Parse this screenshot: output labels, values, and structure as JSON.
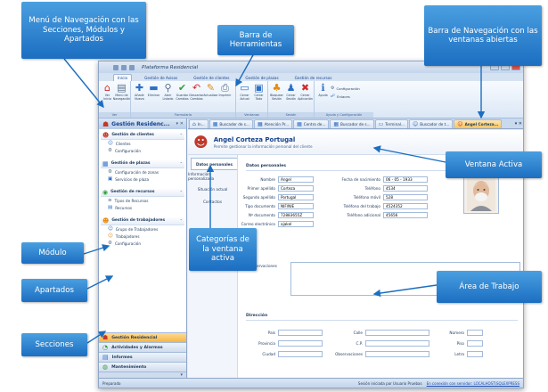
{
  "app": {
    "title": "Plataforma Residencial"
  },
  "ribbon_tabs": [
    "Inicio",
    "Gestión de Avisos",
    "Gestión de clientes",
    "Gestión de plazas",
    "Gestión de recursos"
  ],
  "ribbon_groups": [
    {
      "label": "Ver",
      "buttons": [
        {
          "label": "Ver Inicio",
          "icon": "home-icon"
        },
        {
          "label": "Menú de Navegación",
          "icon": "nav-menu-icon"
        }
      ]
    },
    {
      "label": "Formulario",
      "buttons": [
        {
          "label": "Añadir Nuevo",
          "icon": "add-icon"
        },
        {
          "label": "Eliminar",
          "icon": "delete-icon"
        },
        {
          "label": "Abrir Listado",
          "icon": "search-icon"
        },
        {
          "label": "Guardar Cambios",
          "icon": "check-icon"
        },
        {
          "label": "Descartar Cambios",
          "icon": "undo-icon"
        },
        {
          "label": "Actualizar",
          "icon": "refresh-icon"
        },
        {
          "label": "Imprimir",
          "icon": "print-icon"
        }
      ]
    },
    {
      "label": "Ventanas",
      "buttons": [
        {
          "label": "Cerrar Actual",
          "icon": "close-window-icon"
        },
        {
          "label": "Cerrar Todo",
          "icon": "close-all-icon"
        }
      ]
    },
    {
      "label": "Sesión",
      "buttons": [
        {
          "label": "Bloquear Sesión",
          "icon": "lock-icon"
        },
        {
          "label": "Cerrar Sesión",
          "icon": "logout-icon"
        },
        {
          "label": "Cerrar Aplicación",
          "icon": "exit-icon"
        }
      ]
    },
    {
      "label": "Ayuda y Configuración",
      "buttons": [
        {
          "label": "Ayuda",
          "icon": "help-icon"
        },
        {
          "label": "Configuración",
          "icon": "gear-icon"
        },
        {
          "label": "Enlaces",
          "icon": "link-icon"
        }
      ]
    }
  ],
  "left_panel": {
    "title": "Gestión Residenc...",
    "modules": [
      {
        "title": "Gestión de clientes",
        "items": [
          "Clientes",
          "Configuración"
        ]
      },
      {
        "title": "Gestión de plazas",
        "items": [
          "Configuración de zonas",
          "Servicios de plaza"
        ]
      },
      {
        "title": "Gestión de recursos",
        "items": [
          "Tipos de Recursos",
          "Recursos"
        ]
      },
      {
        "title": "Gestión de trabajadores",
        "items": [
          "Grupo de Trabajadores",
          "Trabajadores",
          "Configuración"
        ]
      }
    ],
    "sections": [
      "Gestión Residencial",
      "Actividades y Alarmas",
      "Informes",
      "Mantenimiento"
    ]
  },
  "window_tabs": [
    "In...",
    "Buscador de s...",
    "Atención Pr...",
    "Centro de...",
    "Buscador de s...",
    "Terminal...",
    "Buscador de t...",
    "Angel Corteza..."
  ],
  "person": {
    "name": "Angel Corteza Portugal",
    "desc": "Permite gestionar la información personal del cliente"
  },
  "categories": [
    "Datos personales",
    "Información personalizada",
    "Situación actual",
    "Contactos"
  ],
  "form": {
    "section_personal": "Datos personales",
    "fields_left": [
      {
        "label": "Nombre",
        "value": "Angel"
      },
      {
        "label": "Primer apellido",
        "value": "Corteza"
      },
      {
        "label": "Segundo apellido",
        "value": "Portugal"
      },
      {
        "label": "Tipo documento",
        "value": "NIF/NIE"
      },
      {
        "label": "Nº documento",
        "value": "72883655Z"
      },
      {
        "label": "Correo electrónico",
        "value": "ajakel"
      }
    ],
    "fields_right": [
      {
        "label": "Fecha de nacimiento",
        "value": "06 - 05 - 1933"
      },
      {
        "label": "Teléfono",
        "value": "4534"
      },
      {
        "label": "Teléfono móvil",
        "value": "528"
      },
      {
        "label": "Teléfono del trabajo",
        "value": "4524352"
      },
      {
        "label": "Teléfono adicional",
        "value": "45656"
      }
    ],
    "obs_label": "Observaciones",
    "section_address": "Dirección",
    "address": [
      {
        "label": "País"
      },
      {
        "label": "Calle"
      },
      {
        "label": "Número"
      },
      {
        "label": "Provincia"
      },
      {
        "label": "C.P."
      },
      {
        "label": "Piso"
      },
      {
        "label": "Ciudad"
      },
      {
        "label": "Observaciones"
      },
      {
        "label": "Letra"
      }
    ]
  },
  "status": {
    "left": "Preparado",
    "session": "Sesión iniciada por Usuario Pruebas",
    "server": "En conexión con servidor: LOCALHOST\\SQLEXPRESS"
  },
  "callouts": {
    "nav_menu": "Menú de Navegación con las Secciones, Módulos y Apartados",
    "toolbar": "Barra de Herramientas",
    "nav_bar": "Barra de Navegación con las ventanas abiertas",
    "active_window": "Ventana  Activa",
    "categories": "Categorías de la ventana activa",
    "module": "Módulo",
    "subsections": "Apartados",
    "workspace": "Área de Trabajo",
    "sections": "Secciones"
  },
  "colors": {
    "callout": "#2a7fd0",
    "active_section": "#f7b540",
    "ribbon": "#dbe7f5"
  }
}
